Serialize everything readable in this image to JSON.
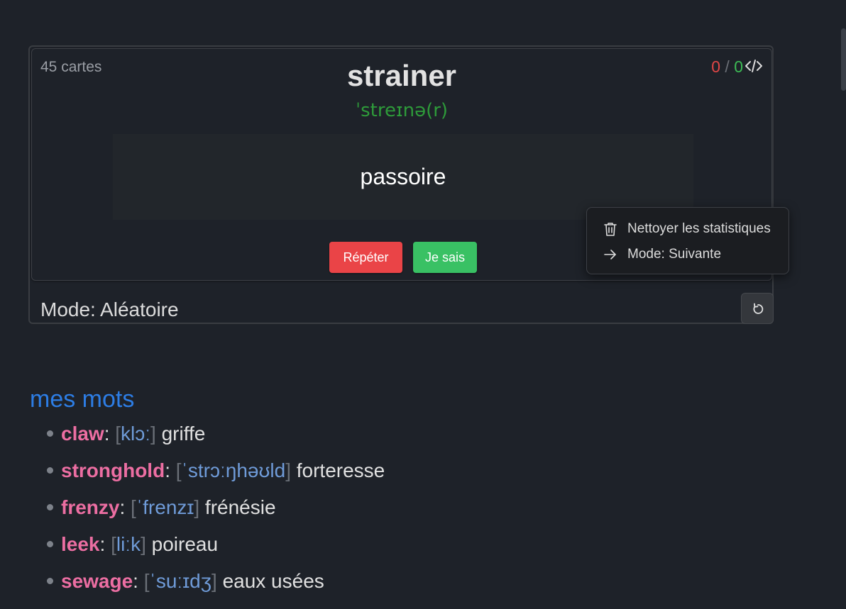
{
  "flashcard": {
    "count_label": "45 cartes",
    "word": "strainer",
    "phonetic": "ˈstreɪnə(r)",
    "translation": "passoire",
    "score": {
      "wrong": "0",
      "separator": "/",
      "right": "0"
    },
    "icons": {
      "source": "code-icon"
    },
    "buttons": {
      "repeat": "Répéter",
      "know": "Je sais"
    },
    "mode_label": "Mode: Aléatoire",
    "reset_icon": "reset-icon"
  },
  "context_menu": {
    "items": [
      {
        "icon": "trash-icon",
        "label": "Nettoyer les statistiques"
      },
      {
        "icon": "arrow-right-icon",
        "label": "Mode: Suivante"
      }
    ]
  },
  "word_list": {
    "title": "mes mots",
    "items": [
      {
        "term": "claw",
        "ipa": "klɔː",
        "translation": "griffe"
      },
      {
        "term": "stronghold",
        "ipa": "ˈstrɔːŋhəʊld",
        "translation": "forteresse"
      },
      {
        "term": "frenzy",
        "ipa": "ˈfrenzɪ",
        "translation": "frénésie"
      },
      {
        "term": "leek",
        "ipa": "liːk",
        "translation": "poireau"
      },
      {
        "term": "sewage",
        "ipa": "ˈsuːɪdʒ",
        "translation": "eaux usées"
      }
    ]
  },
  "colors": {
    "background": "#1e2229",
    "accent_blue": "#2d7de4",
    "term_pink": "#ec6ea2",
    "ipa_blue": "#6f9bd8",
    "phonetic_green": "#2e9b3a",
    "repeat_red": "#ea4447",
    "know_green": "#39c164"
  }
}
